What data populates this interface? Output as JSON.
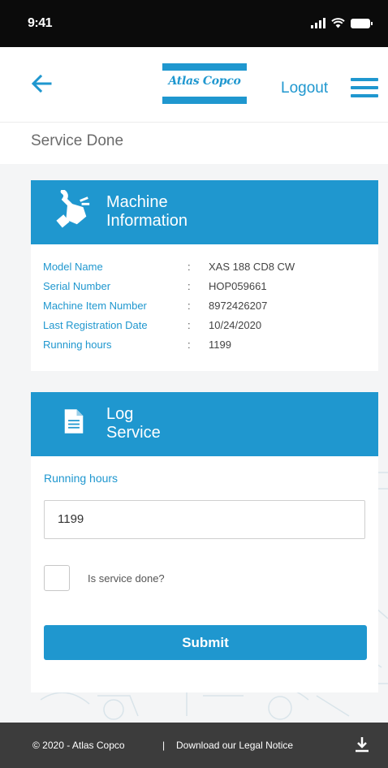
{
  "status_bar": {
    "time": "9:41"
  },
  "header": {
    "logo_text": "Atlas Copco",
    "logout_label": "Logout"
  },
  "page": {
    "title": "Service Done"
  },
  "machine_card": {
    "title_line1": "Machine",
    "title_line2": "Information",
    "rows": [
      {
        "label": "Model Name",
        "colon": ":",
        "value": "XAS 188 CD8 CW"
      },
      {
        "label": "Serial Number",
        "colon": ":",
        "value": "HOP059661"
      },
      {
        "label": "Machine Item Number",
        "colon": ":",
        "value": "8972426207"
      },
      {
        "label": "Last Registration Date",
        "colon": ":",
        "value": "10/24/2020"
      },
      {
        "label": "Running hours",
        "colon": ":",
        "value": "1199"
      }
    ]
  },
  "log_card": {
    "title_line1": "Log",
    "title_line2": "Service",
    "running_hours_label": "Running hours",
    "running_hours_value": "1199",
    "checkbox_label": "Is service done?",
    "submit_label": "Submit"
  },
  "footer": {
    "copyright": "© 2020 - Atlas Copco",
    "separator": "|",
    "legal_link": "Download our Legal Notice"
  },
  "colors": {
    "brand_blue": "#1f97cf",
    "status_bar": "#0b0b0b",
    "footer_bg": "#3c3c3c",
    "content_bg": "#f4f5f6"
  },
  "icons": {
    "back": "arrow-left-icon",
    "menu": "hamburger-menu-icon",
    "machine": "machine-hand-icon",
    "log": "document-icon",
    "download": "download-icon"
  }
}
